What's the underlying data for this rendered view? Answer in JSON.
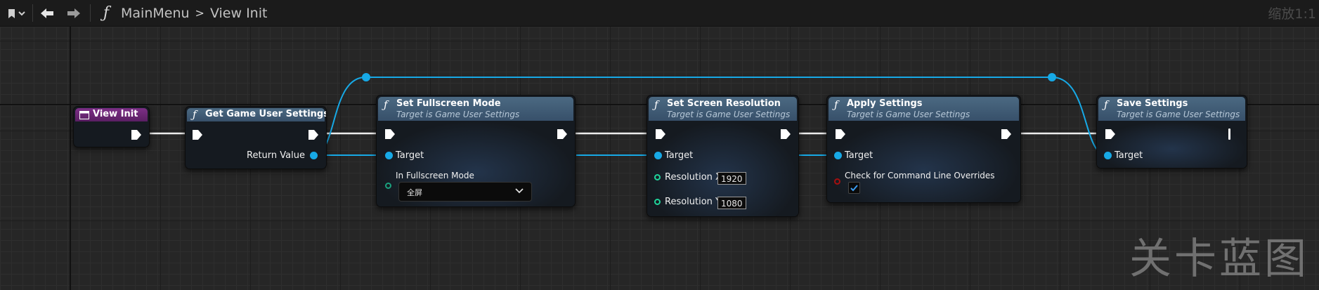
{
  "toolbar": {
    "bookmark_icon": "bookmark-icon",
    "back_icon": "back-arrow-icon",
    "forward_icon": "forward-arrow-icon",
    "function_icon": "function-icon",
    "function_glyph": "ƒ",
    "breadcrumb": [
      "MainMenu",
      "View Init"
    ],
    "breadcrumb_separator": ">",
    "zoom": "缩放1:1"
  },
  "nodes": {
    "view_init": {
      "title": "View Init",
      "header_color": "#6b2775"
    },
    "get_game_user_settings": {
      "title": "Get Game User Settings",
      "return_label": "Return Value"
    },
    "set_fullscreen_mode": {
      "title": "Set Fullscreen Mode",
      "subtitle": "Target is Game User Settings",
      "target_label": "Target",
      "mode_label": "In Fullscreen Mode",
      "mode_value": "全屏"
    },
    "set_screen_resolution": {
      "title": "Set Screen Resolution",
      "subtitle": "Target is Game User Settings",
      "target_label": "Target",
      "res_x_label": "Resolution X",
      "res_x_value": "1920",
      "res_y_label": "Resolution Y",
      "res_y_value": "1080"
    },
    "apply_settings": {
      "title": "Apply Settings",
      "subtitle": "Target is Game User Settings",
      "target_label": "Target",
      "check_label": "Check for Command Line Overrides",
      "check_value": true
    },
    "save_settings": {
      "title": "Save Settings",
      "subtitle": "Target is Game User Settings",
      "target_label": "Target"
    }
  },
  "colors": {
    "object_pin": "#17a9e6",
    "byte_pin": "#1aa27e",
    "int_pin": "#1fd49a",
    "bool_pin": "#a50f0f",
    "function_header": "#3f5c78",
    "event_header": "#6b2775"
  },
  "watermark": "关卡蓝图"
}
